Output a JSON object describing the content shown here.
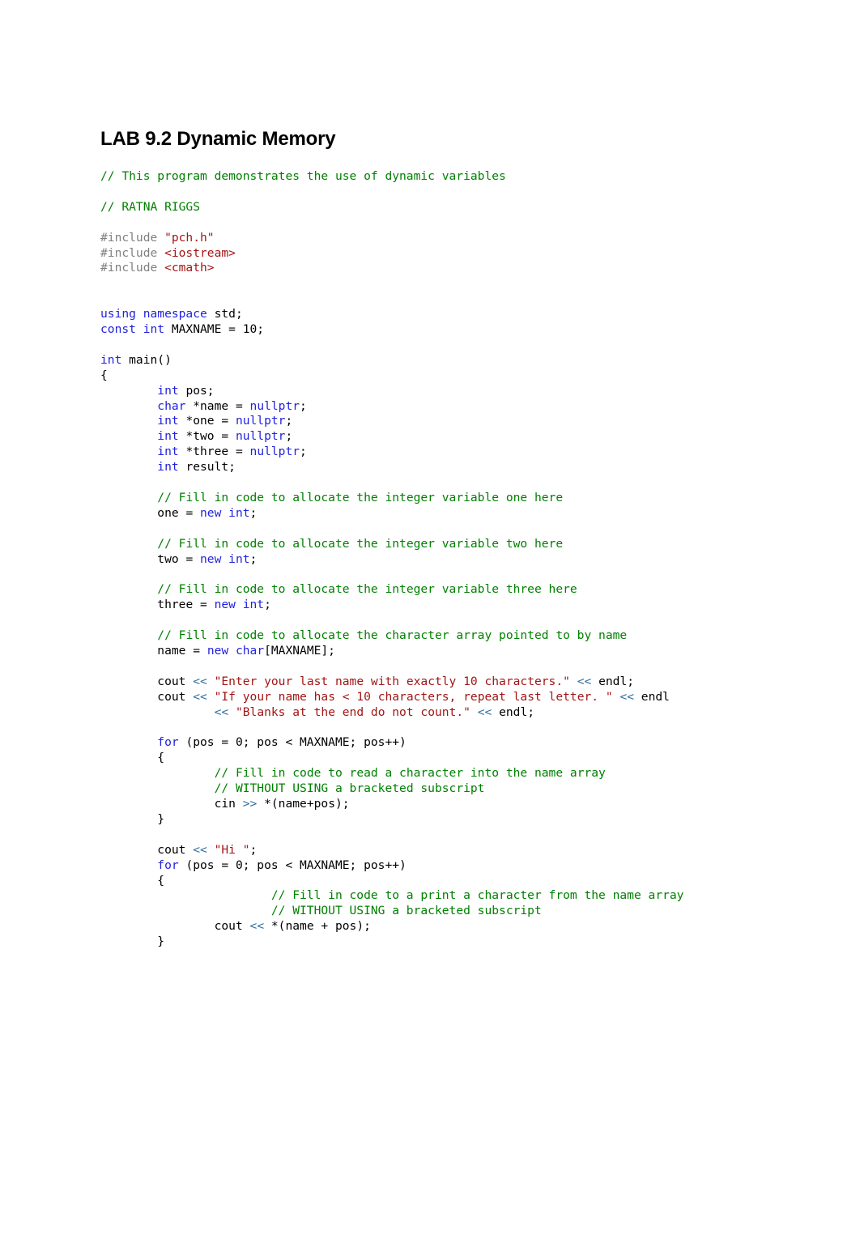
{
  "document": {
    "title": "LAB 9.2 Dynamic Memory"
  },
  "code": {
    "language": "cpp",
    "lines": [
      {
        "id": "l1",
        "indent": 0,
        "tokens": [
          {
            "t": "// This program demonstrates the use of dynamic variables",
            "c": "cmt"
          }
        ]
      },
      {
        "id": "l2",
        "indent": 0,
        "tokens": []
      },
      {
        "id": "l3",
        "indent": 0,
        "tokens": [
          {
            "t": "// RATNA RIGGS",
            "c": "cmt"
          }
        ]
      },
      {
        "id": "l4",
        "indent": 0,
        "tokens": []
      },
      {
        "id": "l5",
        "indent": 0,
        "tokens": [
          {
            "t": "#include ",
            "c": "pre"
          },
          {
            "t": "\"pch.h\"",
            "c": "str"
          }
        ]
      },
      {
        "id": "l6",
        "indent": 0,
        "tokens": [
          {
            "t": "#include ",
            "c": "pre"
          },
          {
            "t": "<iostream>",
            "c": "str"
          }
        ]
      },
      {
        "id": "l7",
        "indent": 0,
        "tokens": [
          {
            "t": "#include ",
            "c": "pre"
          },
          {
            "t": "<cmath>",
            "c": "str"
          }
        ]
      },
      {
        "id": "l8",
        "indent": 0,
        "tokens": []
      },
      {
        "id": "l9",
        "indent": 0,
        "tokens": []
      },
      {
        "id": "l10",
        "indent": 0,
        "tokens": [
          {
            "t": "using namespace",
            "c": "kw"
          },
          {
            "t": " std;",
            "c": "pln"
          }
        ]
      },
      {
        "id": "l11",
        "indent": 0,
        "tokens": [
          {
            "t": "const int",
            "c": "kw"
          },
          {
            "t": " MAXNAME = 10;",
            "c": "pln"
          }
        ]
      },
      {
        "id": "l12",
        "indent": 0,
        "tokens": []
      },
      {
        "id": "l13",
        "indent": 0,
        "tokens": [
          {
            "t": "int",
            "c": "kw"
          },
          {
            "t": " main()",
            "c": "pln"
          }
        ]
      },
      {
        "id": "l14",
        "indent": 0,
        "tokens": [
          {
            "t": "{",
            "c": "pln"
          }
        ]
      },
      {
        "id": "l15",
        "indent": 1,
        "tokens": [
          {
            "t": "int",
            "c": "kw"
          },
          {
            "t": " pos;",
            "c": "pln"
          }
        ]
      },
      {
        "id": "l16",
        "indent": 1,
        "tokens": [
          {
            "t": "char",
            "c": "kw"
          },
          {
            "t": " *name = ",
            "c": "pln"
          },
          {
            "t": "nullptr",
            "c": "kw"
          },
          {
            "t": ";",
            "c": "pln"
          }
        ]
      },
      {
        "id": "l17",
        "indent": 1,
        "tokens": [
          {
            "t": "int",
            "c": "kw"
          },
          {
            "t": " *one = ",
            "c": "pln"
          },
          {
            "t": "nullptr",
            "c": "kw"
          },
          {
            "t": ";",
            "c": "pln"
          }
        ]
      },
      {
        "id": "l18",
        "indent": 1,
        "tokens": [
          {
            "t": "int",
            "c": "kw"
          },
          {
            "t": " *two = ",
            "c": "pln"
          },
          {
            "t": "nullptr",
            "c": "kw"
          },
          {
            "t": ";",
            "c": "pln"
          }
        ]
      },
      {
        "id": "l19",
        "indent": 1,
        "tokens": [
          {
            "t": "int",
            "c": "kw"
          },
          {
            "t": " *three = ",
            "c": "pln"
          },
          {
            "t": "nullptr",
            "c": "kw"
          },
          {
            "t": ";",
            "c": "pln"
          }
        ]
      },
      {
        "id": "l20",
        "indent": 1,
        "tokens": [
          {
            "t": "int",
            "c": "kw"
          },
          {
            "t": " result;",
            "c": "pln"
          }
        ]
      },
      {
        "id": "l21",
        "indent": 0,
        "tokens": []
      },
      {
        "id": "l22",
        "indent": 1,
        "tokens": [
          {
            "t": "// Fill in code to allocate the integer variable one here",
            "c": "cmt"
          }
        ]
      },
      {
        "id": "l23",
        "indent": 1,
        "tokens": [
          {
            "t": "one = ",
            "c": "pln"
          },
          {
            "t": "new int",
            "c": "kw"
          },
          {
            "t": ";",
            "c": "pln"
          }
        ]
      },
      {
        "id": "l24",
        "indent": 0,
        "tokens": []
      },
      {
        "id": "l25",
        "indent": 1,
        "tokens": [
          {
            "t": "// Fill in code to allocate the integer variable two here",
            "c": "cmt"
          }
        ]
      },
      {
        "id": "l26",
        "indent": 1,
        "tokens": [
          {
            "t": "two = ",
            "c": "pln"
          },
          {
            "t": "new int",
            "c": "kw"
          },
          {
            "t": ";",
            "c": "pln"
          }
        ]
      },
      {
        "id": "l27",
        "indent": 0,
        "tokens": []
      },
      {
        "id": "l28",
        "indent": 1,
        "tokens": [
          {
            "t": "// Fill in code to allocate the integer variable three here",
            "c": "cmt"
          }
        ]
      },
      {
        "id": "l29",
        "indent": 1,
        "tokens": [
          {
            "t": "three = ",
            "c": "pln"
          },
          {
            "t": "new int",
            "c": "kw"
          },
          {
            "t": ";",
            "c": "pln"
          }
        ]
      },
      {
        "id": "l30",
        "indent": 0,
        "tokens": []
      },
      {
        "id": "l31",
        "indent": 1,
        "tokens": [
          {
            "t": "// Fill in code to allocate the character array pointed to by name",
            "c": "cmt"
          }
        ]
      },
      {
        "id": "l32",
        "indent": 1,
        "tokens": [
          {
            "t": "name = ",
            "c": "pln"
          },
          {
            "t": "new char",
            "c": "kw"
          },
          {
            "t": "[MAXNAME];",
            "c": "pln"
          }
        ]
      },
      {
        "id": "l33",
        "indent": 0,
        "tokens": []
      },
      {
        "id": "l34",
        "indent": 1,
        "tokens": [
          {
            "t": "cout ",
            "c": "pln"
          },
          {
            "t": "<<",
            "c": "op"
          },
          {
            "t": " ",
            "c": "pln"
          },
          {
            "t": "\"Enter your last name with exactly 10 characters.\"",
            "c": "str"
          },
          {
            "t": " ",
            "c": "pln"
          },
          {
            "t": "<<",
            "c": "op"
          },
          {
            "t": " endl;",
            "c": "pln"
          }
        ]
      },
      {
        "id": "l35",
        "indent": 1,
        "tokens": [
          {
            "t": "cout ",
            "c": "pln"
          },
          {
            "t": "<<",
            "c": "op"
          },
          {
            "t": " ",
            "c": "pln"
          },
          {
            "t": "\"If your name has < 10 characters, repeat last letter. \"",
            "c": "str"
          },
          {
            "t": " ",
            "c": "pln"
          },
          {
            "t": "<<",
            "c": "op"
          },
          {
            "t": " endl",
            "c": "pln"
          }
        ]
      },
      {
        "id": "l36",
        "indent": 2,
        "tokens": [
          {
            "t": "<<",
            "c": "op"
          },
          {
            "t": " ",
            "c": "pln"
          },
          {
            "t": "\"Blanks at the end do not count.\"",
            "c": "str"
          },
          {
            "t": " ",
            "c": "pln"
          },
          {
            "t": "<<",
            "c": "op"
          },
          {
            "t": " endl;",
            "c": "pln"
          }
        ]
      },
      {
        "id": "l37",
        "indent": 0,
        "tokens": []
      },
      {
        "id": "l38",
        "indent": 1,
        "tokens": [
          {
            "t": "for",
            "c": "kw"
          },
          {
            "t": " (pos = 0; pos < MAXNAME; pos++)",
            "c": "pln"
          }
        ]
      },
      {
        "id": "l39",
        "indent": 1,
        "tokens": [
          {
            "t": "{",
            "c": "pln"
          }
        ]
      },
      {
        "id": "l40",
        "indent": 2,
        "tokens": [
          {
            "t": "// Fill in code to read a character into the name array",
            "c": "cmt"
          }
        ]
      },
      {
        "id": "l41",
        "indent": 2,
        "tokens": [
          {
            "t": "// WITHOUT USING a bracketed subscript",
            "c": "cmt"
          }
        ]
      },
      {
        "id": "l42",
        "indent": 2,
        "tokens": [
          {
            "t": "cin ",
            "c": "pln"
          },
          {
            "t": ">>",
            "c": "op"
          },
          {
            "t": " *(name+pos);",
            "c": "pln"
          }
        ]
      },
      {
        "id": "l43",
        "indent": 1,
        "tokens": [
          {
            "t": "}",
            "c": "pln"
          }
        ]
      },
      {
        "id": "l44",
        "indent": 0,
        "tokens": []
      },
      {
        "id": "l45",
        "indent": 1,
        "tokens": [
          {
            "t": "cout ",
            "c": "pln"
          },
          {
            "t": "<<",
            "c": "op"
          },
          {
            "t": " ",
            "c": "pln"
          },
          {
            "t": "\"Hi \"",
            "c": "str"
          },
          {
            "t": ";",
            "c": "pln"
          }
        ]
      },
      {
        "id": "l46",
        "indent": 1,
        "tokens": [
          {
            "t": "for",
            "c": "kw"
          },
          {
            "t": " (pos = 0; pos < MAXNAME; pos++)",
            "c": "pln"
          }
        ]
      },
      {
        "id": "l47",
        "indent": 1,
        "tokens": [
          {
            "t": "{",
            "c": "pln"
          }
        ]
      },
      {
        "id": "l48",
        "indent": 3,
        "tokens": [
          {
            "t": "// Fill in code to a print a character from the name array",
            "c": "cmt"
          }
        ]
      },
      {
        "id": "l49",
        "indent": 3,
        "tokens": [
          {
            "t": "// WITHOUT USING a bracketed subscript",
            "c": "cmt"
          }
        ]
      },
      {
        "id": "l50",
        "indent": 2,
        "tokens": [
          {
            "t": "cout ",
            "c": "pln"
          },
          {
            "t": "<<",
            "c": "op"
          },
          {
            "t": " *(name + pos);",
            "c": "pln"
          }
        ]
      },
      {
        "id": "l51",
        "indent": 1,
        "tokens": [
          {
            "t": "}",
            "c": "pln"
          }
        ]
      }
    ]
  },
  "colors": {
    "comment": "#008000",
    "keyword": "#2222DD",
    "string": "#A31515",
    "preprocessor": "#808080",
    "operator": "#2F6F9F",
    "plain": "#000000",
    "background": "#FFFFFF"
  }
}
